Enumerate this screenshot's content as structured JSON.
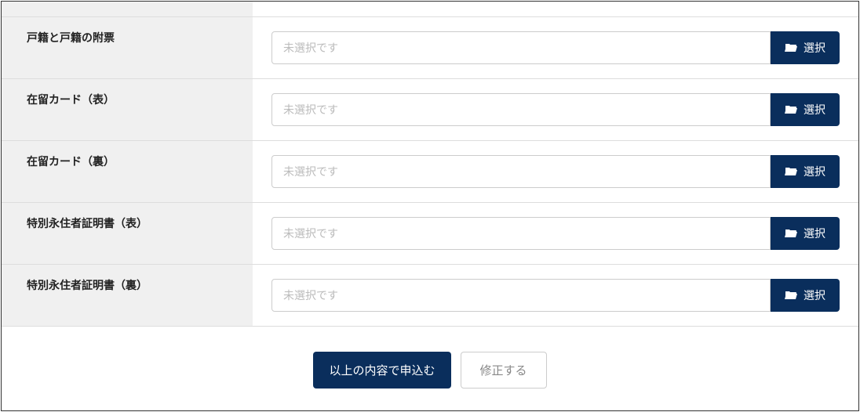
{
  "form": {
    "fields": [
      {
        "label": "戸籍と戸籍の附票",
        "placeholder": "未選択です"
      },
      {
        "label": "在留カード（表）",
        "placeholder": "未選択です"
      },
      {
        "label": "在留カード（裏）",
        "placeholder": "未選択です"
      },
      {
        "label": "特別永住者証明書（表）",
        "placeholder": "未選択です"
      },
      {
        "label": "特別永住者証明書（裏）",
        "placeholder": "未選択です"
      }
    ],
    "select_button_label": "選択"
  },
  "buttons": {
    "submit": "以上の内容で申込む",
    "revise": "修正する"
  }
}
